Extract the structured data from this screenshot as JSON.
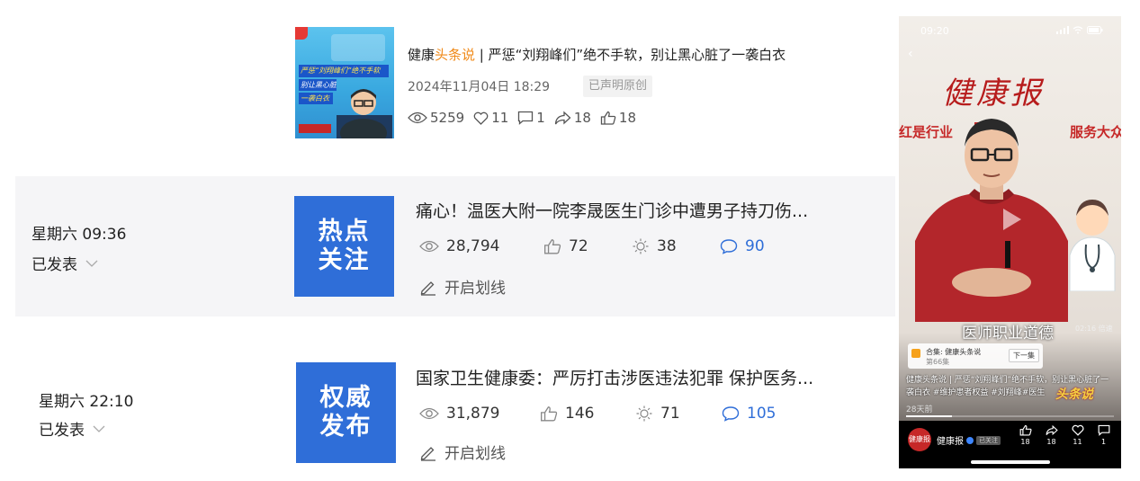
{
  "article1": {
    "title_prefix": "健康",
    "title_highlight": "头条说",
    "title_rest": " | 严惩“刘翔峰们”绝不手软，别让黑心脏了一袭白衣",
    "date": "2024年11月04日 18:29",
    "badge": "已声明原创",
    "thumb_tag1": "严惩“刘翔峰们”绝不手软",
    "thumb_tag2": "别让黑心脏了",
    "thumb_tag3": "一袭白衣",
    "stats": {
      "views": "5259",
      "likes": "11",
      "comments": "1",
      "shares": "18",
      "thumbs": "18"
    }
  },
  "article2": {
    "day": "星期六 09:36",
    "status": "已发表",
    "thumb_line1": "热点",
    "thumb_line2": "关注",
    "headline": "痛心！温医大附一院李晟医生门诊中遭男子持刀伤...",
    "views": "28,794",
    "likes": "72",
    "shares": "38",
    "comments": "90",
    "highlight_link": "开启划线"
  },
  "article3": {
    "day": "星期六 22:10",
    "status": "已发表",
    "thumb_line1": "权威",
    "thumb_line2": "发布",
    "headline": "国家卫生健康委：严厉打击涉医违法犯罪 保护医务...",
    "views": "31,879",
    "likes": "146",
    "shares": "71",
    "comments": "105",
    "highlight_link": "开启划线"
  },
  "phone": {
    "time": "09:20",
    "brand": "健康报",
    "banner_left": "红是行业",
    "banner_right": "服务大众",
    "caption": "医师职业道德",
    "duration": "02:16  倍速",
    "collection_title": "合集: 健康头条说",
    "collection_sub": "第66集",
    "next_label": "下一集",
    "description": "健康头条说 | 严惩“刘翔峰们”绝不手软，别让黑心脏了一袭白衣 #维护患者权益 #刘翔峰#医生",
    "overlay_logo": "头条说",
    "ago": "28天前",
    "progress": 0.22,
    "account": "健康报",
    "follow": "已关注",
    "avatar_text": "健康报",
    "actions": {
      "likes": "18",
      "shares": "18",
      "favorites": "11",
      "comments": "1"
    }
  }
}
